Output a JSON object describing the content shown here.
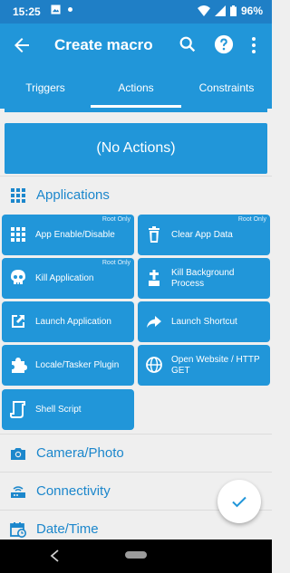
{
  "status_bar": {
    "time": "15:25",
    "battery": "96%"
  },
  "app_bar": {
    "title": "Create macro"
  },
  "tabs": [
    {
      "label": "Triggers"
    },
    {
      "label": "Actions"
    },
    {
      "label": "Constraints"
    }
  ],
  "no_actions_label": "(No Actions)",
  "categories": {
    "applications": "Applications",
    "camera": "Camera/Photo",
    "connectivity": "Connectivity",
    "datetime": "Date/Time"
  },
  "actions": [
    {
      "label": "App Enable/Disable",
      "badge": "Root Only",
      "icon": "grid-icon"
    },
    {
      "label": "Clear App Data",
      "badge": "Root Only",
      "icon": "trash-icon"
    },
    {
      "label": "Kill Application",
      "badge": "Root Only",
      "icon": "skull-icon"
    },
    {
      "label": "Kill Background Process",
      "badge": "",
      "icon": "tombstone-icon"
    },
    {
      "label": "Launch Application",
      "badge": "",
      "icon": "launch-icon"
    },
    {
      "label": "Launch Shortcut",
      "badge": "",
      "icon": "share-arrow-icon"
    },
    {
      "label": "Locale/Tasker Plugin",
      "badge": "",
      "icon": "puzzle-icon"
    },
    {
      "label": "Open Website / HTTP GET",
      "badge": "",
      "icon": "globe-icon"
    },
    {
      "label": "Shell Script",
      "badge": "",
      "icon": "script-icon"
    }
  ],
  "colors": {
    "primary": "#2196d9",
    "status": "#1f7fc6",
    "category_text": "#1c87cc",
    "background": "#efefef"
  }
}
